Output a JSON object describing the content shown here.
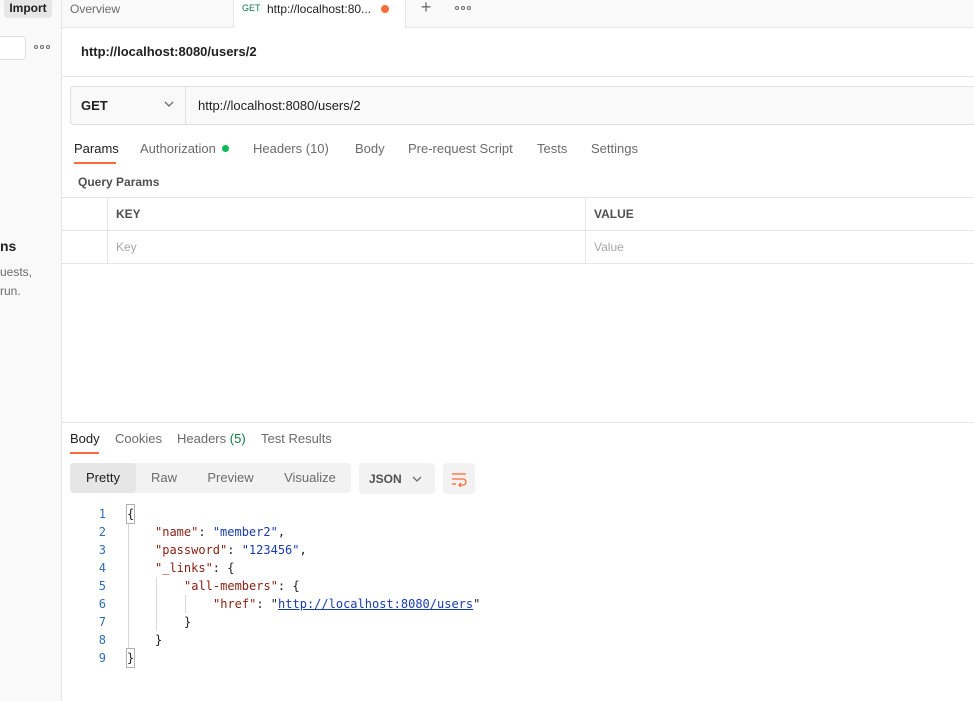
{
  "sidebar": {
    "import_label": "Import",
    "empty_title_partial": "ns",
    "empty_line1_partial": "uests,",
    "empty_line2_partial": "run."
  },
  "tabs": {
    "overview_label": "Overview",
    "request_method": "GET",
    "request_label": "http://localhost:80..."
  },
  "request": {
    "title": "http://localhost:8080/users/2",
    "method": "GET",
    "url": "http://localhost:8080/users/2",
    "tabs": [
      "Params",
      "Authorization",
      "Headers (10)",
      "Body",
      "Pre-request Script",
      "Tests",
      "Settings"
    ],
    "query_params_label": "Query Params",
    "table": {
      "key_header": "KEY",
      "value_header": "VALUE",
      "key_placeholder": "Key",
      "value_placeholder": "Value"
    }
  },
  "response": {
    "tabs": {
      "body": "Body",
      "cookies": "Cookies",
      "headers_label": "Headers",
      "headers_count": "(5)",
      "test_results": "Test Results"
    },
    "views": [
      "Pretty",
      "Raw",
      "Preview",
      "Visualize"
    ],
    "format": "JSON",
    "lines": [
      {
        "num": "1",
        "text": "{"
      },
      {
        "num": "2",
        "key": "\"name\"",
        "value": "\"member2\"",
        "tail": ","
      },
      {
        "num": "3",
        "key": "\"password\"",
        "value": "\"123456\"",
        "tail": ","
      },
      {
        "num": "4",
        "key": "\"_links\"",
        "open": "{"
      },
      {
        "num": "5",
        "key": "\"all-members\"",
        "open": "{"
      },
      {
        "num": "6",
        "key": "\"href\"",
        "link": "http://localhost:8080/users"
      },
      {
        "num": "7",
        "text": "}"
      },
      {
        "num": "8",
        "text": "}"
      },
      {
        "num": "9",
        "text": "}"
      }
    ]
  },
  "colors": {
    "accent": "#ff6c37",
    "auth_status": "#0cbb52",
    "get_method": "#0c7b43"
  }
}
